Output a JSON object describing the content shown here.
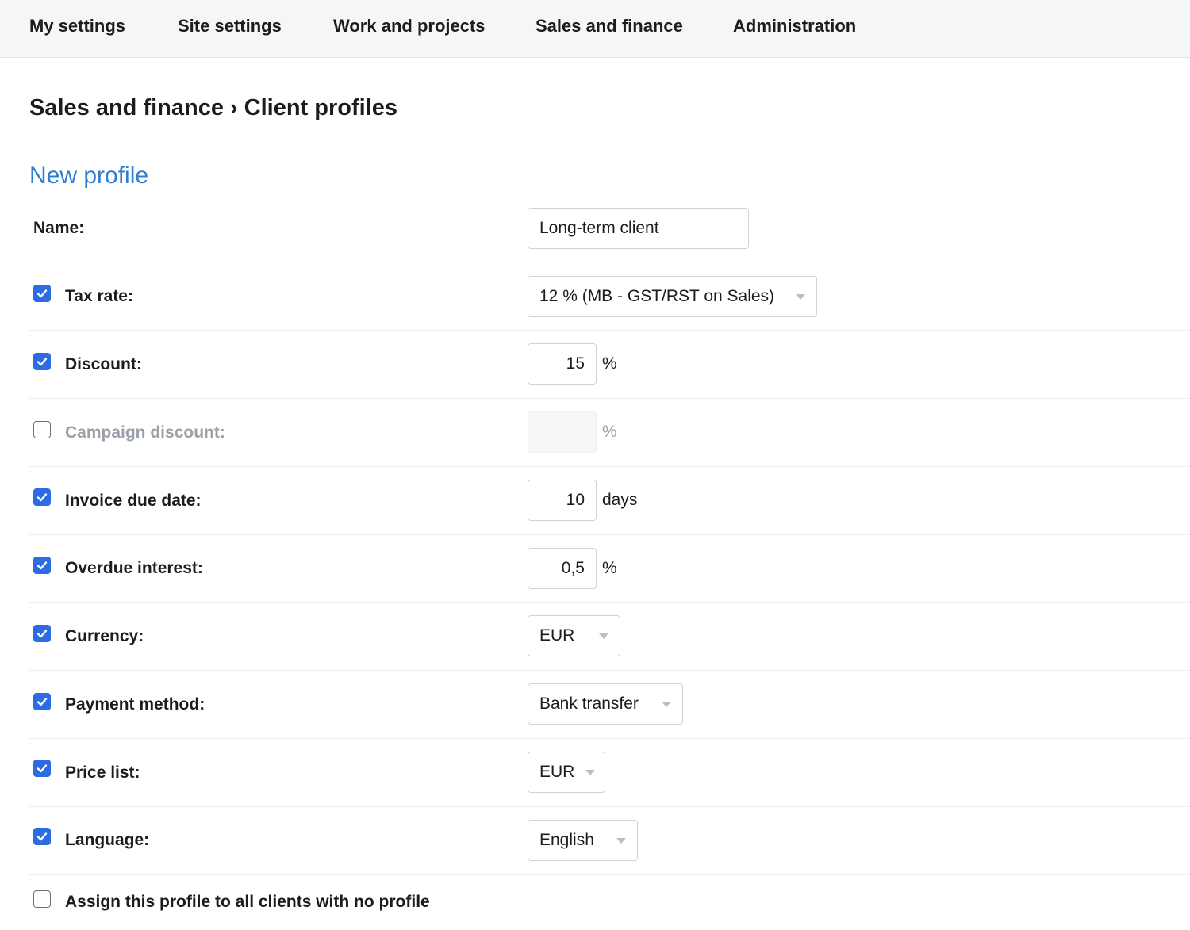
{
  "nav": {
    "items": [
      "My settings",
      "Site settings",
      "Work and projects",
      "Sales and finance",
      "Administration"
    ]
  },
  "breadcrumb": {
    "parent": "Sales and finance",
    "separator": "›",
    "current": "Client profiles"
  },
  "section_title": "New profile",
  "form": {
    "name": {
      "label": "Name:",
      "value": "Long-term client"
    },
    "tax_rate": {
      "label": "Tax rate:",
      "checked": true,
      "value": "12 % (MB - GST/RST on Sales)"
    },
    "discount": {
      "label": "Discount:",
      "checked": true,
      "value": "15",
      "unit": "%"
    },
    "campaign_discount": {
      "label": "Campaign discount:",
      "checked": false,
      "value": "",
      "unit": "%"
    },
    "invoice_due_date": {
      "label": "Invoice due date:",
      "checked": true,
      "value": "10",
      "unit": "days"
    },
    "overdue_interest": {
      "label": "Overdue interest:",
      "checked": true,
      "value": "0,5",
      "unit": "%"
    },
    "currency": {
      "label": "Currency:",
      "checked": true,
      "value": "EUR"
    },
    "payment_method": {
      "label": "Payment method:",
      "checked": true,
      "value": "Bank transfer"
    },
    "price_list": {
      "label": "Price list:",
      "checked": true,
      "value": "EUR"
    },
    "language": {
      "label": "Language:",
      "checked": true,
      "value": "English"
    },
    "assign_all": {
      "label": "Assign this profile to all clients with no profile",
      "checked": false
    }
  },
  "colors": {
    "accent": "#2f7dd1",
    "checkbox": "#2d6be4",
    "nav_background": "#f5f6f8",
    "disabled_text": "#9aa0a8"
  }
}
